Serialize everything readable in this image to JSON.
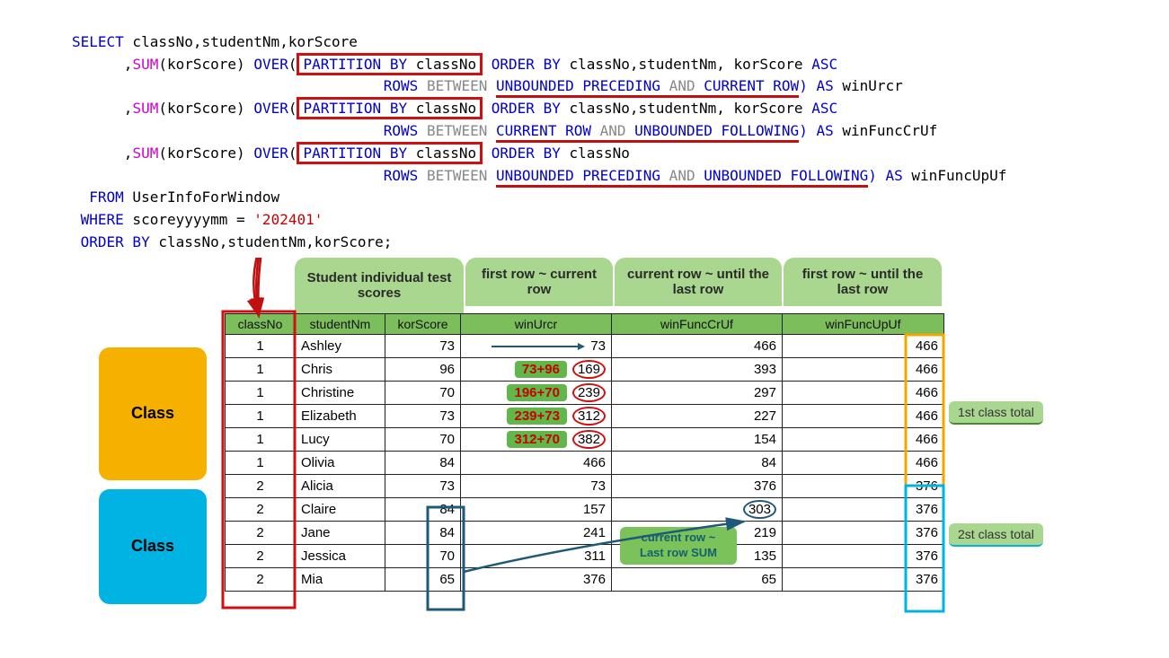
{
  "sql": {
    "select": "SELECT",
    "cols": " classNo,studentNm,korScore",
    "comma": "      ,",
    "sum": "SUM",
    "korScore": "(korScore) ",
    "over": "OVER",
    "lparen": "(",
    "partby": "PARTITION BY",
    "classNo": " classNo",
    "orderby": " ORDER BY",
    "ob_full": " classNo,studentNm, korScore ",
    "asc": "ASC",
    "ob_short": " classNo",
    "rows": "ROWS",
    "between": " BETWEEN ",
    "unb_prec": "UNBOUNDED PRECEDING",
    "and": " AND ",
    "cur_row": "CURRENT ROW",
    "unb_foll": "UNBOUNDED FOLLOWING",
    "rparen_as": ") AS",
    "alias1": " winUrcr",
    "alias2": " winFuncCrUf",
    "alias3": " winFuncUpUf",
    "from": "  FROM",
    "table": " UserInfoForWindow",
    "where": " WHERE",
    "wcond": " scoreyyyymm = ",
    "wval": "'202401'",
    "ob_kw": " ORDER BY",
    "ob_cols": " classNo,studentNm,korScore;",
    "indent": "                                    "
  },
  "pill": {
    "student": "Student individual test scores",
    "first_cur": "first row ~ current row",
    "cur_last": "current row ~ until the last row",
    "first_last": "first row ~ until the last row"
  },
  "th": {
    "classNo": "classNo",
    "studentNm": "studentNm",
    "korScore": "korScore",
    "winUrcr": "winUrcr",
    "winFuncCrUf": "winFuncCrUf",
    "winFuncUpUf": "winFuncUpUf"
  },
  "classLabel": "Class",
  "side1": "1st class total",
  "side2": "2st class total",
  "note_curlast": "current row ~ Last row SUM",
  "rows": [
    {
      "classNo": "1",
      "studentNm": "Ashley",
      "korScore": "73",
      "calc": "",
      "winUrcr": "73",
      "winFuncCrUf": "466",
      "winFuncUpUf": "466"
    },
    {
      "classNo": "1",
      "studentNm": "Chris",
      "korScore": "96",
      "calc": "73+96",
      "winUrcr": "169",
      "winFuncCrUf": "393",
      "winFuncUpUf": "466"
    },
    {
      "classNo": "1",
      "studentNm": "Christine",
      "korScore": "70",
      "calc": "196+70",
      "winUrcr": "239",
      "winFuncCrUf": "297",
      "winFuncUpUf": "466"
    },
    {
      "classNo": "1",
      "studentNm": "Elizabeth",
      "korScore": "73",
      "calc": "239+73",
      "winUrcr": "312",
      "winFuncCrUf": "227",
      "winFuncUpUf": "466"
    },
    {
      "classNo": "1",
      "studentNm": "Lucy",
      "korScore": "70",
      "calc": "312+70",
      "winUrcr": "382",
      "winFuncCrUf": "154",
      "winFuncUpUf": "466"
    },
    {
      "classNo": "1",
      "studentNm": "Olivia",
      "korScore": "84",
      "calc": "",
      "winUrcr": "466",
      "winFuncCrUf": "84",
      "winFuncUpUf": "466"
    },
    {
      "classNo": "2",
      "studentNm": "Alicia",
      "korScore": "73",
      "calc": "",
      "winUrcr": "73",
      "winFuncCrUf": "376",
      "winFuncUpUf": "376"
    },
    {
      "classNo": "2",
      "studentNm": "Claire",
      "korScore": "84",
      "calc": "",
      "winUrcr": "157",
      "winFuncCrUf": "303",
      "winFuncUpUf": "376"
    },
    {
      "classNo": "2",
      "studentNm": "Jane",
      "korScore": "84",
      "calc": "",
      "winUrcr": "241",
      "winFuncCrUf": "219",
      "winFuncUpUf": "376"
    },
    {
      "classNo": "2",
      "studentNm": "Jessica",
      "korScore": "70",
      "calc": "",
      "winUrcr": "311",
      "winFuncCrUf": "135",
      "winFuncUpUf": "376"
    },
    {
      "classNo": "2",
      "studentNm": "Mia",
      "korScore": "65",
      "calc": "",
      "winUrcr": "376",
      "winFuncCrUf": "65",
      "winFuncUpUf": "376"
    }
  ]
}
